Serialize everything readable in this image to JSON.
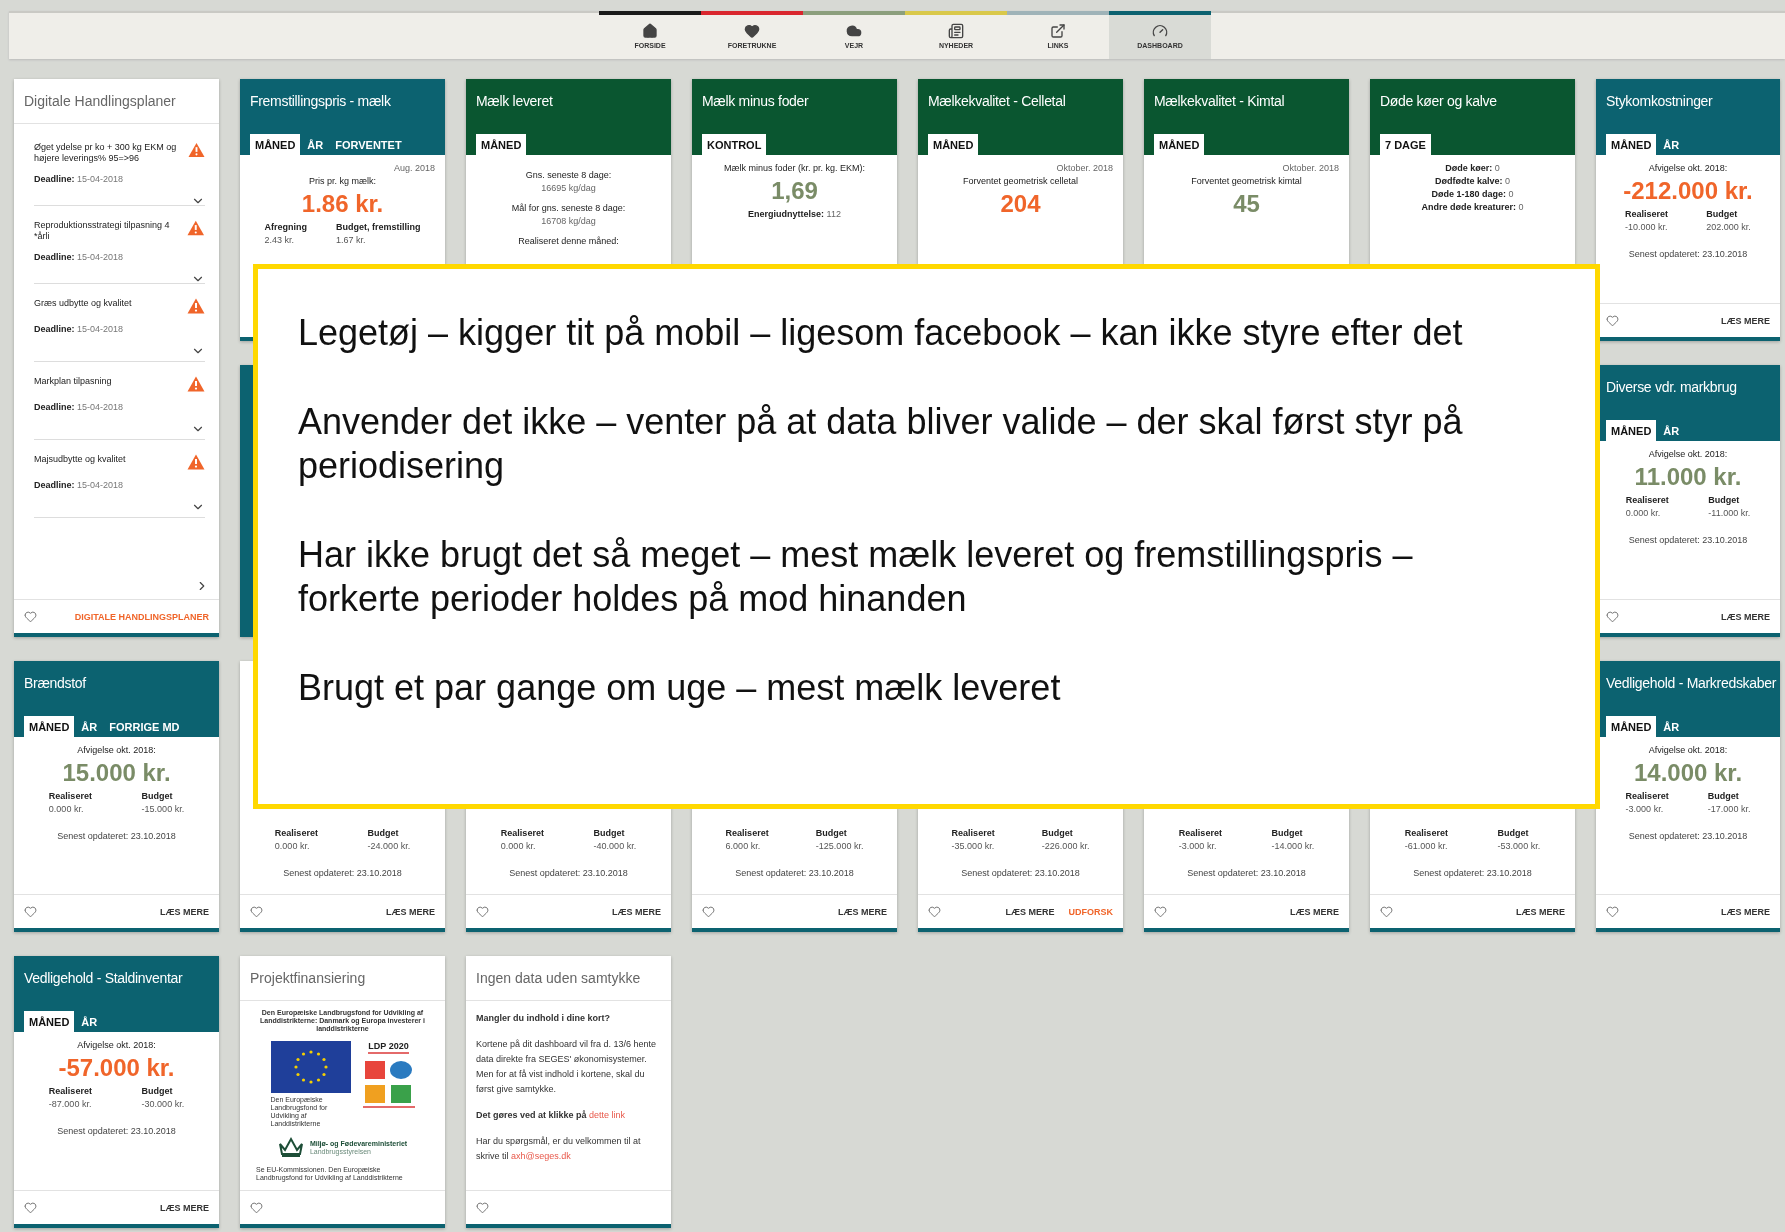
{
  "nav": {
    "tabs": [
      {
        "label": "FORSIDE",
        "color": "#1a1a1a",
        "selected": false
      },
      {
        "label": "FORETRUKNE",
        "color": "#d9262e",
        "selected": false
      },
      {
        "label": "VEJR",
        "color": "#8c9f7d",
        "selected": false
      },
      {
        "label": "NYHEDER",
        "color": "#d9c84a",
        "selected": false
      },
      {
        "label": "LINKS",
        "color": "#9fb3b8",
        "selected": false
      },
      {
        "label": "DASHBOARD",
        "color": "#0c6270",
        "selected": true
      }
    ]
  },
  "cards": [
    {
      "kind": "plans",
      "title": "Digitale Handlingsplaner",
      "items": [
        {
          "title": "Øget ydelse pr ko + 300 kg EKM og højere leverings% 95=>96",
          "deadline": "**Deadline:** 15-04-2018"
        },
        {
          "title": "Reproduktionsstrategi tilpasning 4 *årli",
          "deadline": "**Deadline:** 15-04-2018"
        },
        {
          "title": "Græs udbytte og kvalitet",
          "deadline": "**Deadline:** 15-04-2018"
        },
        {
          "title": "Markplan tilpasning",
          "deadline": "**Deadline:** 15-04-2018"
        },
        {
          "title": "Majsudbytte og kvalitet",
          "deadline": "**Deadline:** 15-04-2018"
        }
      ],
      "footer": [
        {
          "label": "DIGITALE HANDLINGSPLANER",
          "kind": "accent"
        }
      ]
    },
    {
      "kind": "metric",
      "color": "#0c6270",
      "title": "Fremstillingspris - mælk",
      "tabs": [
        {
          "label": "MÅNED",
          "selected": true
        },
        {
          "label": "ÅR",
          "selected": false
        },
        {
          "label": "FORVENTET",
          "selected": false
        }
      ],
      "date": "Aug. 2018",
      "label": "Pris pr. kg mælk:",
      "value": {
        "text": "1.86 kr.",
        "color": "#f0652a"
      },
      "stats": [
        {
          "label": "Afregning",
          "value": "2.43 kr."
        },
        {
          "label": "Budget, fremstilling",
          "value": "1.67 kr."
        }
      ]
    },
    {
      "kind": "metric",
      "color": "#0a5630",
      "title": "Mælk leveret",
      "tabs": [
        {
          "label": "MÅNED",
          "selected": true
        }
      ],
      "lines": [
        {
          "text": "Gns. seneste 8 dage:",
          "strong": true
        },
        {
          "text": "16695 kg/dag",
          "strong": false
        },
        {
          "text": "Mål for gns. seneste 8 dage:",
          "strong": true
        },
        {
          "text": "16708 kg/dag",
          "strong": false
        },
        {
          "text": "Realiseret denne måned:",
          "strong": true
        }
      ]
    },
    {
      "kind": "metric",
      "color": "#0a5630",
      "title": "Mælk minus foder",
      "tabs": [
        {
          "label": "KONTROL",
          "selected": true
        }
      ],
      "label": "Mælk minus foder (kr. pr. kg. EKM):",
      "value": {
        "text": "1,69",
        "color": "#7a8c67"
      },
      "lines": [
        {
          "text": "**Energiudnyttelse:** 112",
          "strong": false
        }
      ]
    },
    {
      "kind": "metric",
      "color": "#0a5630",
      "title": "Mælkekvalitet - Celletal",
      "tabs": [
        {
          "label": "MÅNED",
          "selected": true
        }
      ],
      "date": "Oktober. 2018",
      "label": "Forventet geometrisk celletal",
      "value": {
        "text": "204",
        "color": "#f0652a"
      }
    },
    {
      "kind": "metric",
      "color": "#0a5630",
      "title": "Mælkekvalitet - Kimtal",
      "tabs": [
        {
          "label": "MÅNED",
          "selected": true
        }
      ],
      "date": "Oktober. 2018",
      "label": "Forventet geometrisk kimtal",
      "value": {
        "text": "45",
        "color": "#7a8c67"
      }
    },
    {
      "kind": "metric",
      "color": "#0a5630",
      "title": "Døde køer og kalve",
      "tabs": [
        {
          "label": "7 DAGE",
          "selected": true
        }
      ],
      "lines": [
        {
          "text": "**Døde køer:** 0",
          "strong": false
        },
        {
          "text": "**Dødfødte kalve:** 0",
          "strong": false
        },
        {
          "text": "**Døde 1-180 dage:** 0",
          "strong": false
        },
        {
          "text": "**Andre døde kreaturer:** 0",
          "strong": false
        }
      ]
    },
    {
      "kind": "metric",
      "color": "#0c6270",
      "title": "Stykomkostninger",
      "tabs": [
        {
          "label": "MÅNED",
          "selected": true
        },
        {
          "label": "ÅR",
          "selected": false
        }
      ],
      "label": "Afvigelse okt. 2018:",
      "value": {
        "text": "-212.000 kr.",
        "color": "#f0652a"
      },
      "stats": [
        {
          "label": "Realiseret",
          "value": "-10.000 kr."
        },
        {
          "label": "Budget",
          "value": "202.000 kr."
        }
      ],
      "updated": "Senest opdateret: 23.10.2018",
      "footer": [
        {
          "label": "LÆS MERE",
          "kind": "plain"
        }
      ]
    },
    {
      "kind": "covered",
      "color": "#0c6270"
    },
    {
      "kind": "covered"
    },
    {
      "kind": "covered"
    },
    {
      "kind": "covered"
    },
    {
      "kind": "covered"
    },
    {
      "kind": "covered"
    },
    {
      "kind": "metric",
      "color": "#0c6270",
      "title": "Diverse vdr. markbrug",
      "tabs": [
        {
          "label": "MÅNED",
          "selected": true
        },
        {
          "label": "ÅR",
          "selected": false
        }
      ],
      "label": "Afvigelse okt. 2018:",
      "value": {
        "text": "11.000 kr.",
        "color": "#7a8c67"
      },
      "stats": [
        {
          "label": "Realiseret",
          "value": "0.000 kr."
        },
        {
          "label": "Budget",
          "value": "-11.000 kr."
        }
      ],
      "updated": "Senest opdateret: 23.10.2018",
      "footer": [
        {
          "label": "LÆS MERE",
          "kind": "plain"
        }
      ]
    },
    {
      "kind": "metric",
      "color": "#0c6270",
      "title": "Brændstof",
      "tabs": [
        {
          "label": "MÅNED",
          "selected": true
        },
        {
          "label": "ÅR",
          "selected": false
        },
        {
          "label": "FORRIGE MD",
          "selected": false
        }
      ],
      "label": "Afvigelse okt. 2018:",
      "value": {
        "text": "15.000 kr.",
        "color": "#7a8c67"
      },
      "stats": [
        {
          "label": "Realiseret",
          "value": "0.000 kr."
        },
        {
          "label": "Budget",
          "value": "-15.000 kr."
        }
      ],
      "updated": "Senest opdateret: 23.10.2018",
      "footer": [
        {
          "label": "LÆS MERE",
          "kind": "plain"
        }
      ]
    },
    {
      "kind": "metric",
      "stats": [
        {
          "label": "Realiseret",
          "value": "0.000 kr."
        },
        {
          "label": "Budget",
          "value": "-24.000 kr."
        }
      ],
      "updated": "Senest opdateret: 23.10.2018",
      "footer": [
        {
          "label": "LÆS MERE",
          "kind": "plain"
        }
      ]
    },
    {
      "kind": "metric",
      "stats": [
        {
          "label": "Realiseret",
          "value": "0.000 kr."
        },
        {
          "label": "Budget",
          "value": "-40.000 kr."
        }
      ],
      "updated": "Senest opdateret: 23.10.2018",
      "footer": [
        {
          "label": "LÆS MERE",
          "kind": "plain"
        }
      ]
    },
    {
      "kind": "metric",
      "stats": [
        {
          "label": "Realiseret",
          "value": "6.000 kr."
        },
        {
          "label": "Budget",
          "value": "-125.000 kr."
        }
      ],
      "updated": "Senest opdateret: 23.10.2018",
      "footer": [
        {
          "label": "LÆS MERE",
          "kind": "plain"
        }
      ]
    },
    {
      "kind": "metric",
      "stats": [
        {
          "label": "Realiseret",
          "value": "-35.000 kr."
        },
        {
          "label": "Budget",
          "value": "-226.000 kr."
        }
      ],
      "updated": "Senest opdateret: 23.10.2018",
      "footer": [
        {
          "label": "LÆS MERE",
          "kind": "plain"
        },
        {
          "label": "UDFORSK",
          "kind": "accent"
        }
      ]
    },
    {
      "kind": "metric",
      "stats": [
        {
          "label": "Realiseret",
          "value": "-3.000 kr."
        },
        {
          "label": "Budget",
          "value": "-14.000 kr."
        }
      ],
      "updated": "Senest opdateret: 23.10.2018",
      "footer": [
        {
          "label": "LÆS MERE",
          "kind": "plain"
        }
      ]
    },
    {
      "kind": "metric",
      "stats": [
        {
          "label": "Realiseret",
          "value": "-61.000 kr."
        },
        {
          "label": "Budget",
          "value": "-53.000 kr."
        }
      ],
      "updated": "Senest opdateret: 23.10.2018",
      "footer": [
        {
          "label": "LÆS MERE",
          "kind": "plain"
        }
      ]
    },
    {
      "kind": "metric",
      "color": "#0c6270",
      "title": "Vedligehold - Markredskaber",
      "tabs": [
        {
          "label": "MÅNED",
          "selected": true
        },
        {
          "label": "ÅR",
          "selected": false
        }
      ],
      "label": "Afvigelse okt. 2018:",
      "value": {
        "text": "14.000 kr.",
        "color": "#7a8c67"
      },
      "stats": [
        {
          "label": "Realiseret",
          "value": "-3.000 kr."
        },
        {
          "label": "Budget",
          "value": "-17.000 kr."
        }
      ],
      "updated": "Senest opdateret: 23.10.2018",
      "footer": [
        {
          "label": "LÆS MERE",
          "kind": "plain"
        }
      ]
    },
    {
      "kind": "metric",
      "color": "#0c6270",
      "title": "Vedligehold - Staldinventar",
      "tabs": [
        {
          "label": "MÅNED",
          "selected": true
        },
        {
          "label": "ÅR",
          "selected": false
        }
      ],
      "label": "Afvigelse okt. 2018:",
      "value": {
        "text": "-57.000 kr.",
        "color": "#f0652a"
      },
      "stats": [
        {
          "label": "Realiseret",
          "value": "-87.000 kr."
        },
        {
          "label": "Budget",
          "value": "-30.000 kr."
        }
      ],
      "updated": "Senest opdateret: 23.10.2018",
      "footer": [
        {
          "label": "LÆS MERE",
          "kind": "plain"
        }
      ]
    },
    {
      "kind": "image",
      "title": "Projektfinansiering",
      "image": {
        "heading": "Den Europæiske Landbrugsfond for Udvikling af Landdistrikterne: Danmark og Europa investerer i landdistrikterne",
        "flag_caption": "Den Europæiske Landbrugsfond for Udvikling af Landdistrikterne",
        "program": "LDP 2020",
        "ministry": "Miljø- og Fødevareministeriet",
        "agency": "Landbrugsstyrelsen",
        "note": "Se EU-Kommissionen. Den Europæiske Landbrugsfond for Udvikling af Landdistrikterne"
      }
    },
    {
      "kind": "text",
      "title": "Ingen data uden samtykke",
      "paragraphs": [
        {
          "text": "Mangler du indhold i dine kort?",
          "strong": true
        },
        {
          "text": "Kortene på dit dashboard vil fra d. 13/6 hente data direkte fra SEGES' økonomisystemer. Men for at få vist indhold i kortene, skal du først give samtykke.",
          "strong": false
        },
        {
          "text": "Det gøres ved at klikke på",
          "strong": true,
          "link": "dette link"
        },
        {
          "text": "Har du spørgsmål, er du velkommen til at skrive til",
          "strong": false,
          "link": "axh@seges.dk"
        }
      ]
    }
  ],
  "overlay": {
    "notes": [
      "Legetøj – kigger tit på mobil – ligesom facebook – kan ikke styre efter det",
      "Anvender det ikke – venter på at data bliver valide – der skal først styr på periodisering",
      "Har ikke brugt det så meget – mest mælk leveret og fremstillingspris – forkerte perioder holdes på mod hinanden",
      "Brugt et par gange om uge – mest mælk leveret"
    ]
  }
}
